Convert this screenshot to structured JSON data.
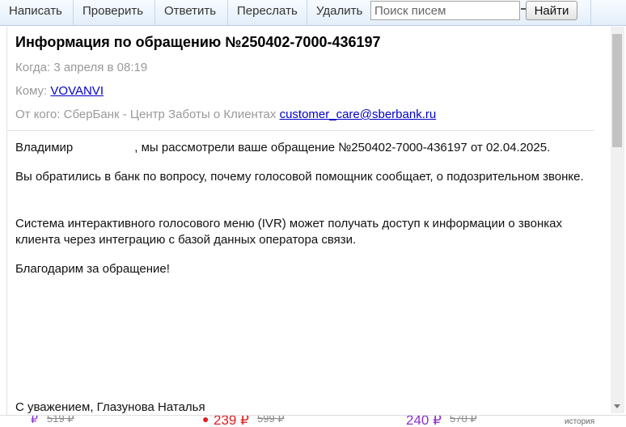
{
  "toolbar": {
    "compose": "Написать",
    "check": "Проверить",
    "reply": "Ответить",
    "forward": "Переслать",
    "delete": "Удалить",
    "search_placeholder": "Поиск писем",
    "find": "Найти"
  },
  "email": {
    "subject": "Информация по обращению №250402-7000-436197",
    "when_label": "Когда:",
    "when_value": "3 апреля в 08:19",
    "to_label": "Кому:",
    "to_value": "VOVANVI",
    "from_label": "От кого:",
    "from_name": "СберБанк - Центр Заботы о Клиентах",
    "from_email": "customer_care@sberbank.ru",
    "greeting_name": "Владимир",
    "greeting_rest": ", мы рассмотрели ваше обращение №250402-7000-436197 от 02.04.2025.",
    "paragraph1": "Вы обратились в банк по вопросу, почему голосовой помощник сообщает, о подозрительном звонке.",
    "paragraph2": "Система интерактивного голосового меню (IVR) может получать доступ к информации о звонках клиента через интеграцию с базой данных оператора связи.",
    "paragraph3": "Благодарим за обращение!",
    "signature": "С уважением, Глазунова Наталья"
  },
  "background_strip": {
    "item1_price_old": "519 ₽",
    "item2_price": "239 ₽",
    "item2_price_old": "599 ₽",
    "item3_price": "240 ₽",
    "item3_price_old": "570 ₽",
    "history_label": "история"
  }
}
